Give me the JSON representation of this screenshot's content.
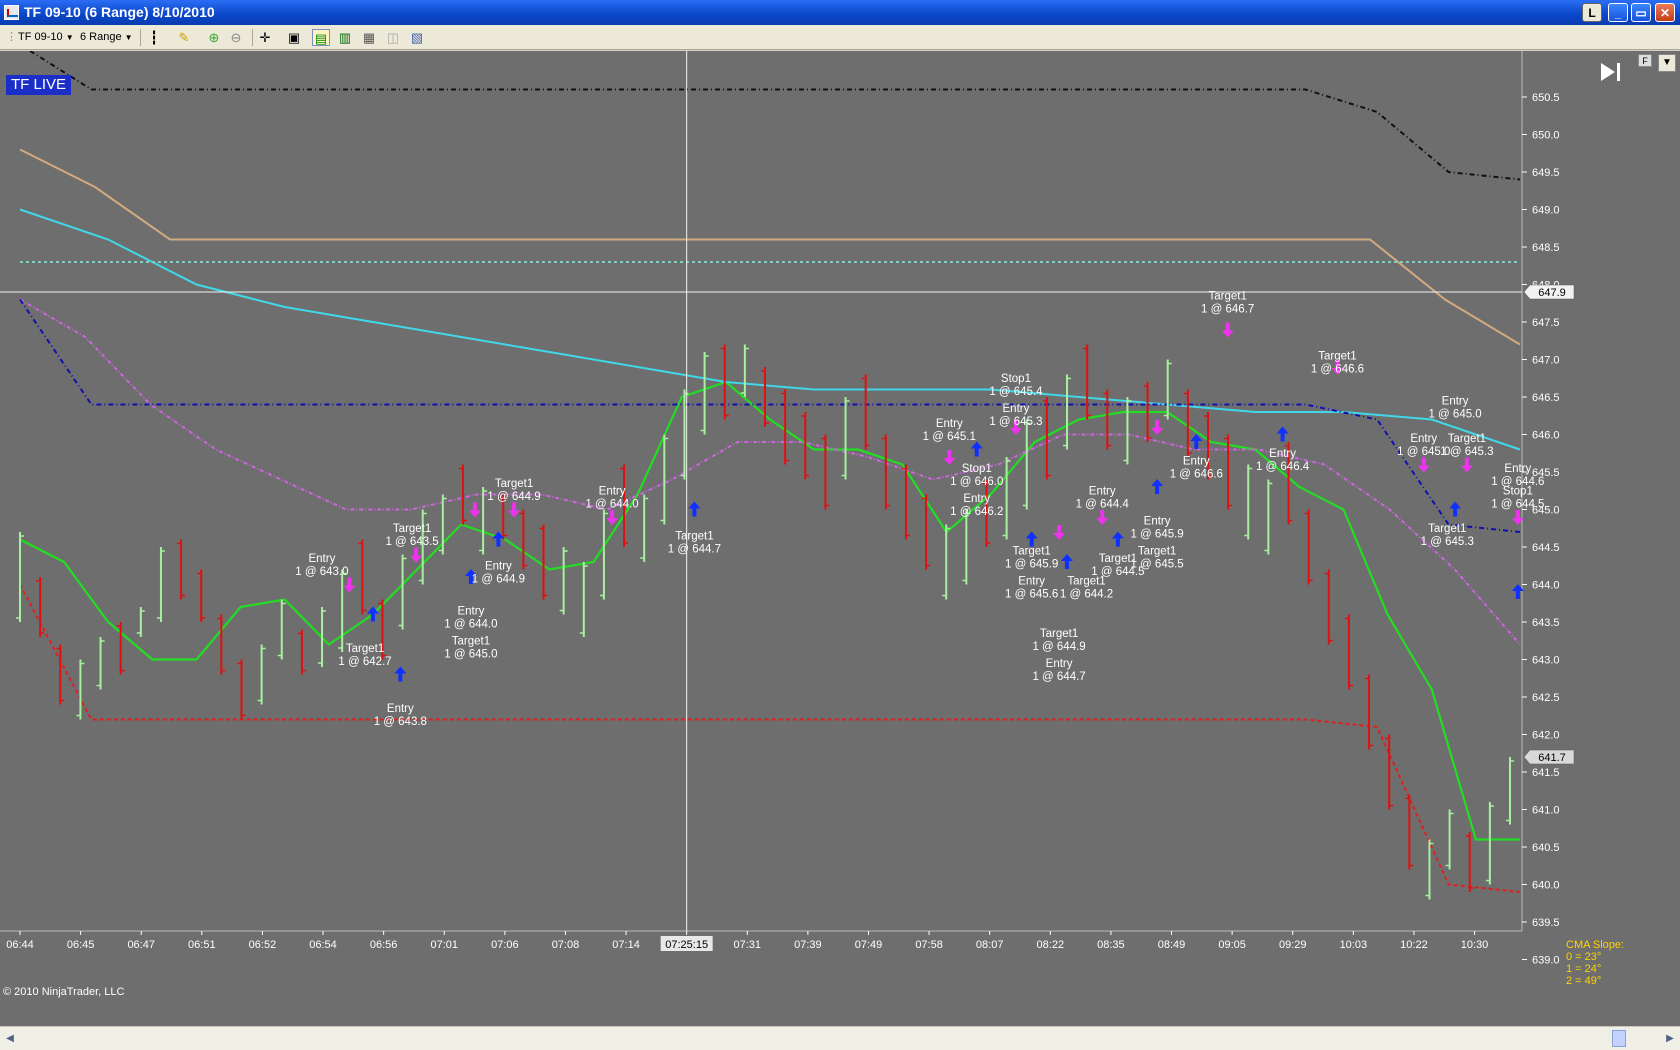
{
  "window": {
    "title": "TF 09-10 (6 Range)  8/10/2010",
    "btn_l": "L",
    "btn_min": "_",
    "btn_max": "▭",
    "btn_close": "✕"
  },
  "toolbar": {
    "instrument": "TF 09-10",
    "period": "6 Range"
  },
  "chart": {
    "badge": "TF LIVE",
    "copyright": "© 2010 NinjaTrader, LLC",
    "cma": {
      "title": "CMA Slope:",
      "lines": [
        "0 = 23°",
        "1 = 24°",
        "2 = 49°"
      ]
    },
    "cursor_time": "07:25:15",
    "price_markers": [
      {
        "label": "647.9",
        "price": 647.9
      },
      {
        "label": "641.7",
        "price": 641.7
      }
    ],
    "colors": {
      "background": "#6e6e6e",
      "up_bar": "#a8f0a0",
      "down_bar": "#e01010",
      "ma_green": "#22dd22",
      "ma_cyan": "#40d8e8",
      "ma_tan": "#d2aa80",
      "ma_magenta": "#cc66dd",
      "black_band": "#111111",
      "blue_band": "#1010b0",
      "red_band": "#e02020",
      "entry_arrow": "#1030ff",
      "target_arrow": "#ee33ee"
    }
  },
  "chart_data": {
    "type": "line",
    "title": "TF 09-10 (6 Range)  8/10/2010",
    "xlabel": "",
    "ylabel": "",
    "ylim": [
      638.7,
      651.0
    ],
    "grid": false,
    "y_ticks": [
      "650.5",
      "650.0",
      "649.5",
      "649.0",
      "648.5",
      "648.0",
      "647.5",
      "647.0",
      "646.5",
      "646.0",
      "645.5",
      "645.0",
      "644.5",
      "644.0",
      "643.5",
      "643.0",
      "642.5",
      "642.0",
      "641.5",
      "641.0",
      "640.5",
      "640.0",
      "639.5",
      "639.0"
    ],
    "x_ticks": [
      "06:44",
      "06:45",
      "06:47",
      "06:51",
      "06:52",
      "06:54",
      "06:56",
      "07:01",
      "07:06",
      "07:08",
      "07:14",
      "07:25:15",
      "07:31",
      "07:39",
      "07:49",
      "07:58",
      "08:07",
      "08:22",
      "08:35",
      "08:49",
      "09:05",
      "09:29",
      "10:03",
      "10:22",
      "10:30"
    ],
    "x_index": [
      0,
      4,
      8,
      12,
      16,
      20,
      24,
      28,
      32,
      36,
      40,
      44,
      48,
      52,
      56,
      60,
      64,
      68,
      72,
      76,
      80,
      84,
      88,
      92,
      96,
      99
    ],
    "series": [
      {
        "name": "",
        "color": "#22dd22",
        "dash": "",
        "values": [
          644.6,
          644.3,
          643.5,
          643.0,
          643.0,
          643.7,
          643.8,
          643.2,
          643.6,
          644.2,
          644.8,
          644.6,
          644.2,
          644.3,
          645.2,
          646.5,
          646.7,
          646.2,
          645.8,
          645.8,
          645.6,
          644.7,
          645.2,
          645.9,
          646.2,
          646.3,
          646.3,
          645.9,
          645.8,
          645.3,
          645.0,
          643.6,
          642.6,
          640.6,
          640.6
        ]
      },
      {
        "name": "",
        "color": "#40d8e8",
        "dash": "",
        "values": [
          649.0,
          648.6,
          648.0,
          647.7,
          647.5,
          647.3,
          647.1,
          646.9,
          646.7,
          646.6,
          646.6,
          646.6,
          646.5,
          646.4,
          646.3,
          646.3,
          646.2,
          645.8
        ]
      },
      {
        "name": "",
        "color": "#cc66dd",
        "dash": "4,2,1,2",
        "values": [
          647.8,
          647.3,
          646.4,
          645.8,
          645.4,
          645.0,
          645.0,
          645.2,
          645.2,
          645.0,
          645.4,
          645.9,
          645.9,
          645.7,
          645.4,
          645.6,
          646.0,
          646.0,
          645.8,
          645.8,
          645.6,
          645.0,
          644.2,
          643.2
        ]
      },
      {
        "name": "",
        "color": "#d2aa80",
        "dash": "",
        "values": [
          649.8,
          649.3,
          648.6,
          648.6,
          648.6,
          648.6,
          648.6,
          648.6,
          648.6,
          648.6,
          648.6,
          648.6,
          648.6,
          648.6,
          648.6,
          648.6,
          648.6,
          648.6,
          648.6,
          647.8,
          647.2
        ]
      },
      {
        "name": "",
        "color": "#111111",
        "dash": "5,3,1,3",
        "values": [
          651.2,
          650.6,
          650.6,
          650.6,
          650.6,
          650.6,
          650.6,
          650.6,
          650.6,
          650.6,
          650.6,
          650.6,
          650.6,
          650.6,
          650.6,
          650.6,
          650.6,
          650.6,
          650.6,
          650.3,
          649.5,
          649.4
        ]
      },
      {
        "name": "",
        "color": "#1010b0",
        "dash": "5,3,1,3",
        "values": [
          647.8,
          646.4,
          646.4,
          646.4,
          646.4,
          646.4,
          646.4,
          646.4,
          646.4,
          646.4,
          646.4,
          646.4,
          646.4,
          646.4,
          646.4,
          646.4,
          646.4,
          646.4,
          646.4,
          646.2,
          644.8,
          644.7
        ]
      },
      {
        "name": "",
        "color": "#e02020",
        "dash": "4,3",
        "values": [
          644.0,
          642.2,
          642.2,
          642.2,
          642.2,
          642.2,
          642.2,
          642.2,
          642.2,
          642.2,
          642.2,
          642.2,
          642.2,
          642.2,
          642.2,
          642.2,
          642.2,
          642.2,
          642.2,
          642.1,
          640.0,
          639.9
        ]
      },
      {
        "name": "",
        "color": "#7fd0c0",
        "dash": "3,3",
        "values": [
          648.3,
          648.3
        ]
      }
    ],
    "bars": [
      {
        "low": 643.5,
        "high": 644.7,
        "up": true
      },
      {
        "low": 643.3,
        "high": 644.1,
        "up": false
      },
      {
        "low": 642.4,
        "high": 643.2,
        "up": false
      },
      {
        "low": 642.2,
        "high": 643.0,
        "up": true
      },
      {
        "low": 642.6,
        "high": 643.3,
        "up": true
      },
      {
        "low": 642.8,
        "high": 643.5,
        "up": false
      },
      {
        "low": 643.3,
        "high": 643.7,
        "up": true
      },
      {
        "low": 643.5,
        "high": 644.5,
        "up": true
      },
      {
        "low": 643.8,
        "high": 644.6,
        "up": false
      },
      {
        "low": 643.5,
        "high": 644.2,
        "up": false
      },
      {
        "low": 642.8,
        "high": 643.6,
        "up": false
      },
      {
        "low": 642.2,
        "high": 643.0,
        "up": false
      },
      {
        "low": 642.4,
        "high": 643.2,
        "up": true
      },
      {
        "low": 643.0,
        "high": 643.8,
        "up": true
      },
      {
        "low": 642.8,
        "high": 643.4,
        "up": false
      },
      {
        "low": 642.9,
        "high": 643.7,
        "up": true
      },
      {
        "low": 643.1,
        "high": 644.2,
        "up": true
      },
      {
        "low": 643.6,
        "high": 644.6,
        "up": false
      },
      {
        "low": 643.0,
        "high": 643.8,
        "up": false
      },
      {
        "low": 643.4,
        "high": 644.4,
        "up": true
      },
      {
        "low": 644.0,
        "high": 645.0,
        "up": true
      },
      {
        "low": 644.4,
        "high": 645.2,
        "up": true
      },
      {
        "low": 644.8,
        "high": 645.6,
        "up": false
      },
      {
        "low": 644.4,
        "high": 645.3,
        "up": true
      },
      {
        "low": 644.6,
        "high": 645.2,
        "up": false
      },
      {
        "low": 644.2,
        "high": 645.0,
        "up": false
      },
      {
        "low": 643.8,
        "high": 644.8,
        "up": false
      },
      {
        "low": 643.6,
        "high": 644.5,
        "up": true
      },
      {
        "low": 643.3,
        "high": 644.3,
        "up": true
      },
      {
        "low": 643.8,
        "high": 645.0,
        "up": true
      },
      {
        "low": 644.5,
        "high": 645.6,
        "up": false
      },
      {
        "low": 644.3,
        "high": 645.2,
        "up": true
      },
      {
        "low": 644.8,
        "high": 646.0,
        "up": true
      },
      {
        "low": 645.4,
        "high": 646.6,
        "up": true
      },
      {
        "low": 646.0,
        "high": 647.1,
        "up": true
      },
      {
        "low": 646.2,
        "high": 647.2,
        "up": false
      },
      {
        "low": 646.5,
        "high": 647.2,
        "up": true
      },
      {
        "low": 646.1,
        "high": 646.9,
        "up": false
      },
      {
        "low": 645.6,
        "high": 646.6,
        "up": false
      },
      {
        "low": 645.4,
        "high": 646.3,
        "up": false
      },
      {
        "low": 645.0,
        "high": 646.0,
        "up": false
      },
      {
        "low": 645.4,
        "high": 646.5,
        "up": true
      },
      {
        "low": 645.8,
        "high": 646.8,
        "up": false
      },
      {
        "low": 645.0,
        "high": 646.0,
        "up": false
      },
      {
        "low": 644.6,
        "high": 645.6,
        "up": false
      },
      {
        "low": 644.2,
        "high": 645.2,
        "up": false
      },
      {
        "low": 643.8,
        "high": 644.8,
        "up": true
      },
      {
        "low": 644.0,
        "high": 645.0,
        "up": true
      },
      {
        "low": 644.5,
        "high": 645.4,
        "up": false
      },
      {
        "low": 644.6,
        "high": 645.7,
        "up": true
      },
      {
        "low": 645.0,
        "high": 646.2,
        "up": true
      },
      {
        "low": 645.4,
        "high": 646.5,
        "up": false
      },
      {
        "low": 645.8,
        "high": 646.8,
        "up": true
      },
      {
        "low": 646.2,
        "high": 647.2,
        "up": false
      },
      {
        "low": 645.8,
        "high": 646.6,
        "up": false
      },
      {
        "low": 645.6,
        "high": 646.5,
        "up": true
      },
      {
        "low": 645.9,
        "high": 646.7,
        "up": false
      },
      {
        "low": 646.2,
        "high": 647.0,
        "up": true
      },
      {
        "low": 645.7,
        "high": 646.6,
        "up": false
      },
      {
        "low": 645.4,
        "high": 646.3,
        "up": false
      },
      {
        "low": 645.0,
        "high": 646.0,
        "up": false
      },
      {
        "low": 644.6,
        "high": 645.6,
        "up": true
      },
      {
        "low": 644.4,
        "high": 645.4,
        "up": true
      },
      {
        "low": 644.8,
        "high": 645.9,
        "up": false
      },
      {
        "low": 644.0,
        "high": 645.0,
        "up": false
      },
      {
        "low": 643.2,
        "high": 644.2,
        "up": false
      },
      {
        "low": 642.6,
        "high": 643.6,
        "up": false
      },
      {
        "low": 641.8,
        "high": 642.8,
        "up": false
      },
      {
        "low": 641.0,
        "high": 642.0,
        "up": false
      },
      {
        "low": 640.2,
        "high": 641.2,
        "up": false
      },
      {
        "low": 639.8,
        "high": 640.6,
        "up": true
      },
      {
        "low": 640.2,
        "high": 641.0,
        "up": true
      },
      {
        "low": 639.9,
        "high": 640.7,
        "up": false
      },
      {
        "low": 640.0,
        "high": 641.1,
        "up": true
      },
      {
        "low": 640.8,
        "high": 641.7,
        "up": true
      }
    ],
    "annotations": [
      {
        "lines": [
          "Entry",
          "1 @ 643.0"
        ],
        "xi": 7.7,
        "price": 644.3
      },
      {
        "lines": [
          "Target1",
          "1 @ 642.7"
        ],
        "xi": 8.8,
        "price": 643.1
      },
      {
        "lines": [
          "Entry",
          "1 @ 643.8"
        ],
        "xi": 9.7,
        "price": 642.3
      },
      {
        "lines": [
          "Target1",
          "1 @ 643.5"
        ],
        "xi": 10.0,
        "price": 644.7
      },
      {
        "lines": [
          "Target1",
          "1 @ 644.9"
        ],
        "xi": 12.6,
        "price": 645.3
      },
      {
        "lines": [
          "Entry",
          "1 @ 644.9"
        ],
        "xi": 12.2,
        "price": 644.2
      },
      {
        "lines": [
          "Entry",
          "1 @ 644.0"
        ],
        "xi": 11.5,
        "price": 643.6
      },
      {
        "lines": [
          "Target1",
          "1 @ 645.0"
        ],
        "xi": 11.5,
        "price": 643.2
      },
      {
        "lines": [
          "Entry",
          "1 @ 644.0"
        ],
        "xi": 15.1,
        "price": 645.2
      },
      {
        "lines": [
          "Target1",
          "1 @ 644.7"
        ],
        "xi": 17.2,
        "price": 644.6
      },
      {
        "lines": [
          "Entry",
          "1 @ 645.1"
        ],
        "xi": 23.7,
        "price": 646.1
      },
      {
        "lines": [
          "Stop1",
          "1 @ 645.4"
        ],
        "xi": 25.4,
        "price": 646.7
      },
      {
        "lines": [
          "Entry",
          "1 @ 645.3"
        ],
        "xi": 25.4,
        "price": 646.3
      },
      {
        "lines": [
          "Stop1",
          "1 @ 646.0"
        ],
        "xi": 24.4,
        "price": 645.5
      },
      {
        "lines": [
          "Entry",
          "1 @ 646.2"
        ],
        "xi": 24.4,
        "price": 645.1
      },
      {
        "lines": [
          "Target1",
          "1 @ 645.9"
        ],
        "xi": 25.8,
        "price": 644.4
      },
      {
        "lines": [
          "Entry",
          "1 @ 645.6"
        ],
        "xi": 25.8,
        "price": 644.0
      },
      {
        "lines": [
          "Target1",
          "1 @ 644.2"
        ],
        "xi": 27.2,
        "price": 644.0
      },
      {
        "lines": [
          "Target1",
          "1 @ 644.9"
        ],
        "xi": 26.5,
        "price": 643.3
      },
      {
        "lines": [
          "Entry",
          "1 @ 644.7"
        ],
        "xi": 26.5,
        "price": 642.9
      },
      {
        "lines": [
          "Entry",
          "1 @ 644.4"
        ],
        "xi": 27.6,
        "price": 645.2
      },
      {
        "lines": [
          "Target1",
          "1 @ 644.5"
        ],
        "xi": 28.0,
        "price": 644.3
      },
      {
        "lines": [
          "Entry",
          "1 @ 645.9"
        ],
        "xi": 29.0,
        "price": 644.8
      },
      {
        "lines": [
          "Target1",
          "1 @ 645.5"
        ],
        "xi": 29.0,
        "price": 644.4
      },
      {
        "lines": [
          "Entry",
          "1 @ 646.6"
        ],
        "xi": 30.0,
        "price": 645.6
      },
      {
        "lines": [
          "Target1",
          "1 @ 646.7"
        ],
        "xi": 30.8,
        "price": 647.8
      },
      {
        "lines": [
          "Entry",
          "1 @ 646.4"
        ],
        "xi": 32.2,
        "price": 645.7
      },
      {
        "lines": [
          "Target1",
          "1 @ 646.6"
        ],
        "xi": 33.6,
        "price": 647.0
      },
      {
        "lines": [
          "Entry",
          "1 @ 645.0"
        ],
        "xi": 36.6,
        "price": 646.4
      },
      {
        "lines": [
          "Entry",
          "1 @ 645.0"
        ],
        "xi": 35.8,
        "price": 645.9
      },
      {
        "lines": [
          "Target1",
          "1 @ 645.3"
        ],
        "xi": 36.9,
        "price": 645.9
      },
      {
        "lines": [
          "Entry",
          "1 @ 644.6"
        ],
        "xi": 38.2,
        "price": 645.5
      },
      {
        "lines": [
          "Stop1",
          "1 @ 644.5"
        ],
        "xi": 38.2,
        "price": 645.2
      },
      {
        "lines": [
          "Target1",
          "1 @ 645.3"
        ],
        "xi": 36.4,
        "price": 644.7
      }
    ],
    "markers": [
      {
        "kind": "entry",
        "xi": 9.0,
        "price": 643.6
      },
      {
        "kind": "entry",
        "xi": 9.7,
        "price": 642.8
      },
      {
        "kind": "entry",
        "xi": 11.5,
        "price": 644.1
      },
      {
        "kind": "entry",
        "xi": 12.2,
        "price": 644.6
      },
      {
        "kind": "entry",
        "xi": 17.2,
        "price": 645.0
      },
      {
        "kind": "entry",
        "xi": 24.4,
        "price": 645.8
      },
      {
        "kind": "entry",
        "xi": 25.8,
        "price": 644.6
      },
      {
        "kind": "entry",
        "xi": 26.7,
        "price": 644.3
      },
      {
        "kind": "entry",
        "xi": 28.0,
        "price": 644.6
      },
      {
        "kind": "entry",
        "xi": 29.0,
        "price": 645.3
      },
      {
        "kind": "entry",
        "xi": 30.0,
        "price": 645.9
      },
      {
        "kind": "entry",
        "xi": 32.2,
        "price": 646.0
      },
      {
        "kind": "entry",
        "xi": 36.6,
        "price": 645.0
      },
      {
        "kind": "entry",
        "xi": 38.2,
        "price": 643.9
      },
      {
        "kind": "target",
        "xi": 8.4,
        "price": 644.0
      },
      {
        "kind": "target",
        "xi": 10.1,
        "price": 644.4
      },
      {
        "kind": "target",
        "xi": 11.6,
        "price": 645.0
      },
      {
        "kind": "target",
        "xi": 12.6,
        "price": 645.0
      },
      {
        "kind": "target",
        "xi": 15.1,
        "price": 644.9
      },
      {
        "kind": "target",
        "xi": 23.7,
        "price": 645.7
      },
      {
        "kind": "target",
        "xi": 25.4,
        "price": 646.1
      },
      {
        "kind": "target",
        "xi": 26.5,
        "price": 644.7
      },
      {
        "kind": "target",
        "xi": 27.6,
        "price": 644.9
      },
      {
        "kind": "target",
        "xi": 29.0,
        "price": 646.1
      },
      {
        "kind": "target",
        "xi": 30.8,
        "price": 647.4
      },
      {
        "kind": "target",
        "xi": 33.6,
        "price": 646.9
      },
      {
        "kind": "target",
        "xi": 35.8,
        "price": 645.6
      },
      {
        "kind": "target",
        "xi": 36.9,
        "price": 645.6
      },
      {
        "kind": "target",
        "xi": 38.2,
        "price": 644.9
      }
    ]
  }
}
